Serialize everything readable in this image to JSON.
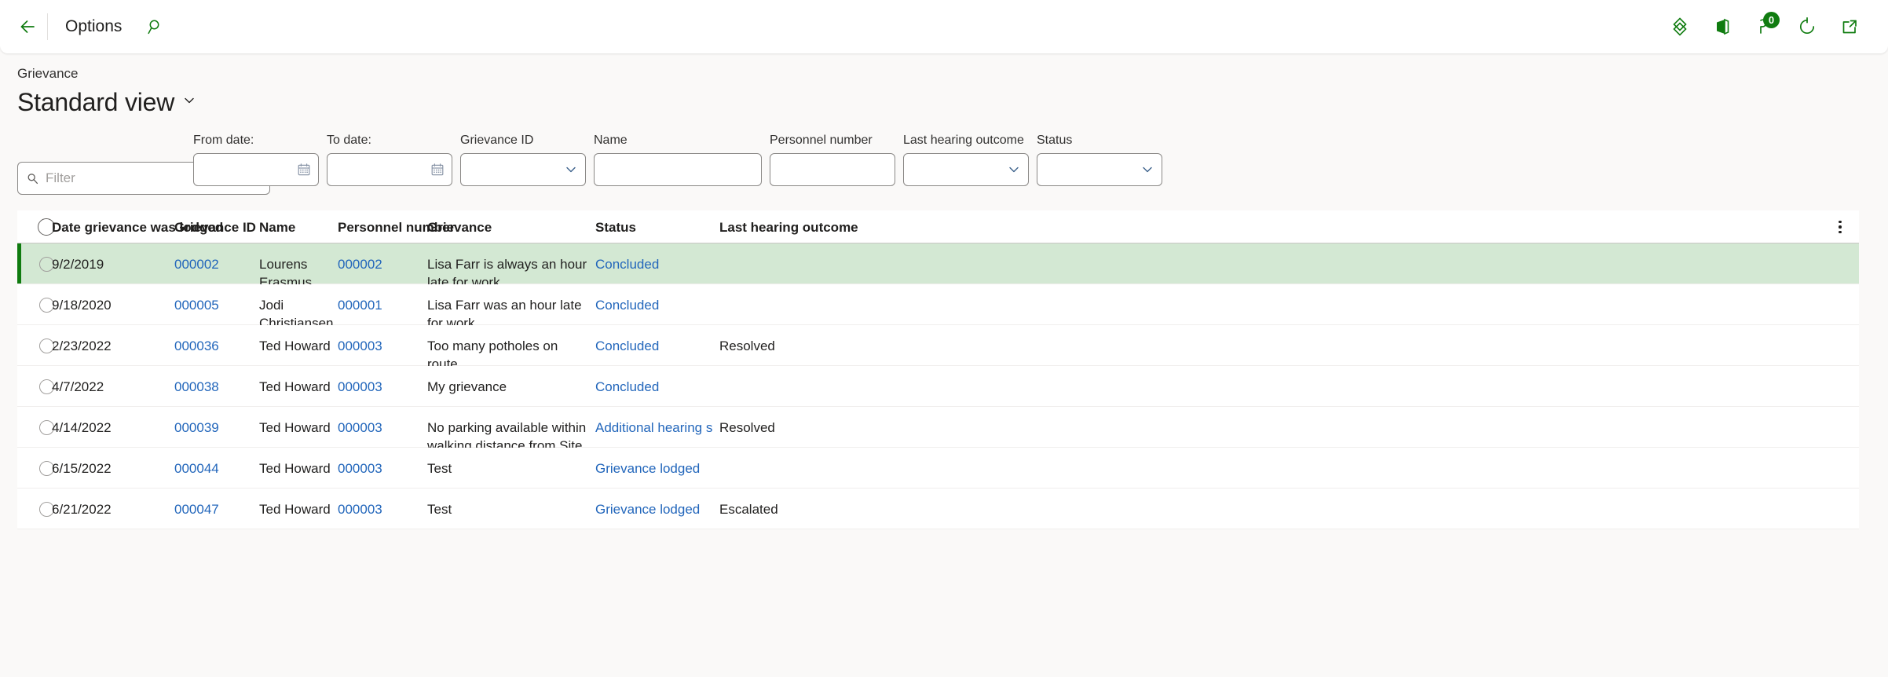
{
  "topbar": {
    "back_icon": "back-arrow-icon",
    "options_label": "Options",
    "search_icon": "search-icon",
    "actions": [
      {
        "icon": "dynamics-diamond-icon",
        "name": "dynamics-logo-button"
      },
      {
        "icon": "office-apps-icon",
        "name": "office-apps-button"
      },
      {
        "icon": "notifications-flag-icon",
        "name": "notifications-button",
        "badge": "0"
      },
      {
        "icon": "refresh-icon",
        "name": "refresh-button"
      },
      {
        "icon": "open-in-new-window-icon",
        "name": "open-in-new-window-button"
      }
    ]
  },
  "header": {
    "breadcrumb": "Grievance",
    "title": "Standard view",
    "title_chevron": "chevron-down-icon"
  },
  "filters": {
    "filter_placeholder": "Filter",
    "filter_value": "",
    "filter_icon": "search-icon",
    "from_date": {
      "label": "From date:",
      "value": "",
      "icon": "calendar-icon"
    },
    "to_date": {
      "label": "To date:",
      "value": "",
      "icon": "calendar-icon"
    },
    "grievance_id": {
      "label": "Grievance ID",
      "value": "",
      "icon": "chevron-down-icon"
    },
    "name": {
      "label": "Name",
      "value": ""
    },
    "personnel_number": {
      "label": "Personnel number",
      "value": ""
    },
    "last_hearing_outcome": {
      "label": "Last hearing outcome",
      "value": "",
      "icon": "chevron-down-icon"
    },
    "status": {
      "label": "Status",
      "value": "",
      "icon": "chevron-down-icon"
    }
  },
  "grid": {
    "columns": [
      "Date grievance was lodged",
      "Grievance ID",
      "Name",
      "Personnel number",
      "Grievance",
      "Status",
      "Last hearing outcome"
    ],
    "rows": [
      {
        "selected": true,
        "date": "9/2/2019",
        "grievance_id": "000002",
        "name": "Lourens Erasmus",
        "personnel_number": "000002",
        "grievance": "Lisa Farr is always an hour late for work.",
        "status": "Concluded",
        "last_hearing_outcome": ""
      },
      {
        "selected": false,
        "date": "9/18/2020",
        "grievance_id": "000005",
        "name": "Jodi Christiansen",
        "personnel_number": "000001",
        "grievance": "Lisa Farr was an hour late for work.",
        "status": "Concluded",
        "last_hearing_outcome": ""
      },
      {
        "selected": false,
        "date": "2/23/2022",
        "grievance_id": "000036",
        "name": "Ted Howard",
        "personnel_number": "000003",
        "grievance": "Too many potholes on route",
        "status": "Concluded",
        "last_hearing_outcome": "Resolved"
      },
      {
        "selected": false,
        "date": "4/7/2022",
        "grievance_id": "000038",
        "name": "Ted Howard",
        "personnel_number": "000003",
        "grievance": "My grievance",
        "status": "Concluded",
        "last_hearing_outcome": ""
      },
      {
        "selected": false,
        "date": "4/14/2022",
        "grievance_id": "000039",
        "name": "Ted Howard",
        "personnel_number": "000003",
        "grievance": "No parking available within walking distance from Site A.",
        "status": "Additional hearing s",
        "last_hearing_outcome": "Resolved"
      },
      {
        "selected": false,
        "date": "6/15/2022",
        "grievance_id": "000044",
        "name": "Ted Howard",
        "personnel_number": "000003",
        "grievance": "Test",
        "status": "Grievance lodged",
        "last_hearing_outcome": ""
      },
      {
        "selected": false,
        "date": "6/21/2022",
        "grievance_id": "000047",
        "name": "Ted Howard",
        "personnel_number": "000003",
        "grievance": "Test",
        "status": "Grievance lodged",
        "last_hearing_outcome": "Escalated"
      }
    ]
  },
  "colors": {
    "accent_green": "#107c10",
    "selected_row_bg": "#d3e8d3",
    "selected_row_bar": "#0f7b0f",
    "link_blue": "#2266bb",
    "page_bg": "#faf9f8"
  }
}
